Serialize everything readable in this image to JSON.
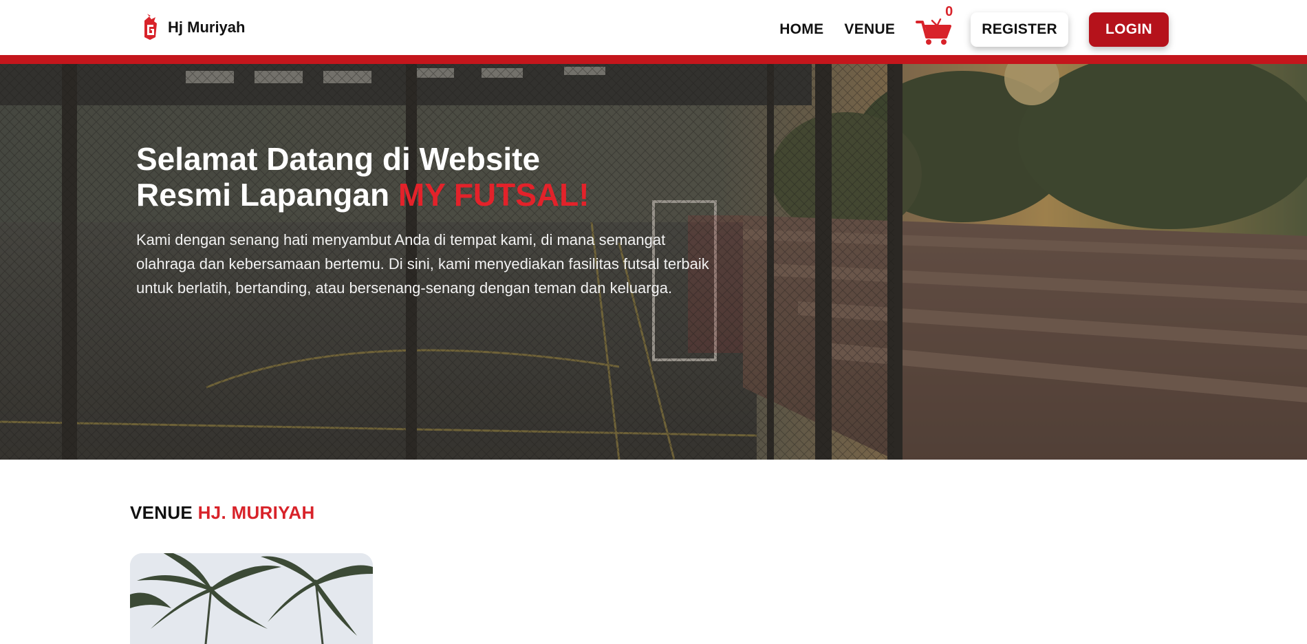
{
  "navbar": {
    "brand_name": "Hj Muriyah",
    "links": [
      "HOME",
      "VENUE"
    ],
    "cart_count": "0",
    "register_label": "REGISTER",
    "login_label": "LOGIN"
  },
  "hero": {
    "title_line1": "Selamat Datang di Website",
    "title_line2": "Resmi Lapangan ",
    "title_accent": "MY FUTSAL!",
    "description": "Kami dengan senang hati menyambut Anda di tempat kami, di mana semangat olahraga dan kebersamaan bertemu. Di sini, kami menyediakan fasilitas futsal terbaik untuk berlatih, bertanding, atau bersenang-senang dengan teman dan keluarga."
  },
  "venue_section": {
    "title": "VENUE ",
    "title_accent": "HJ. MURIYAH"
  },
  "colors": {
    "brand_red": "#c4161c",
    "accent_red": "#e3222a",
    "login_bg": "#b5121b"
  },
  "icons": [
    "brand-logo-icon",
    "shopping-cart-icon"
  ]
}
